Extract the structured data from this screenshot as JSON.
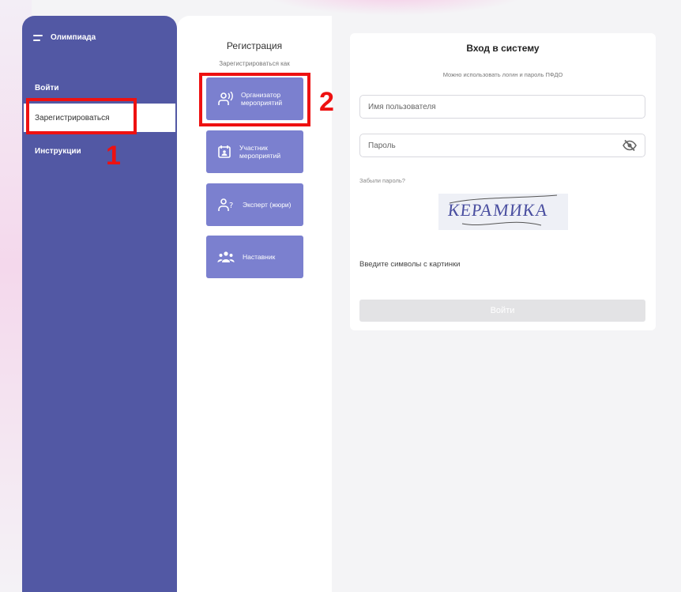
{
  "sidebar": {
    "title": "Олимпиада",
    "items": [
      {
        "label": "Войти"
      },
      {
        "label": "Зарегистрироваться"
      },
      {
        "label": "Инструкции"
      }
    ]
  },
  "registration": {
    "title": "Регистрация",
    "subtitle": "Зарегистрироваться как",
    "roles": [
      {
        "label": "Организатор мероприятий",
        "icon": "organizer-icon"
      },
      {
        "label": "Участник мероприятий",
        "icon": "participant-icon"
      },
      {
        "label": "Эксперт (жюри)",
        "icon": "expert-icon"
      },
      {
        "label": "Наставник",
        "icon": "mentor-icon"
      }
    ]
  },
  "login_card": {
    "title": "Вход в систему",
    "hint": "Можно использовать логин и пароль ПФДО",
    "username_placeholder": "Имя пользователя",
    "password_placeholder": "Пароль",
    "forgot_password": "Забыли пароль?",
    "captcha_text": "КЕРАМИКА",
    "captcha_label": "Введите символы с картинки",
    "submit_label": "Войти"
  },
  "annotations": [
    "1",
    "2"
  ],
  "colors": {
    "sidebar": "#5258a4",
    "role_button": "#7b80cf",
    "annotation_red": "#ee1111",
    "disabled_button": "#e3e3e5"
  }
}
